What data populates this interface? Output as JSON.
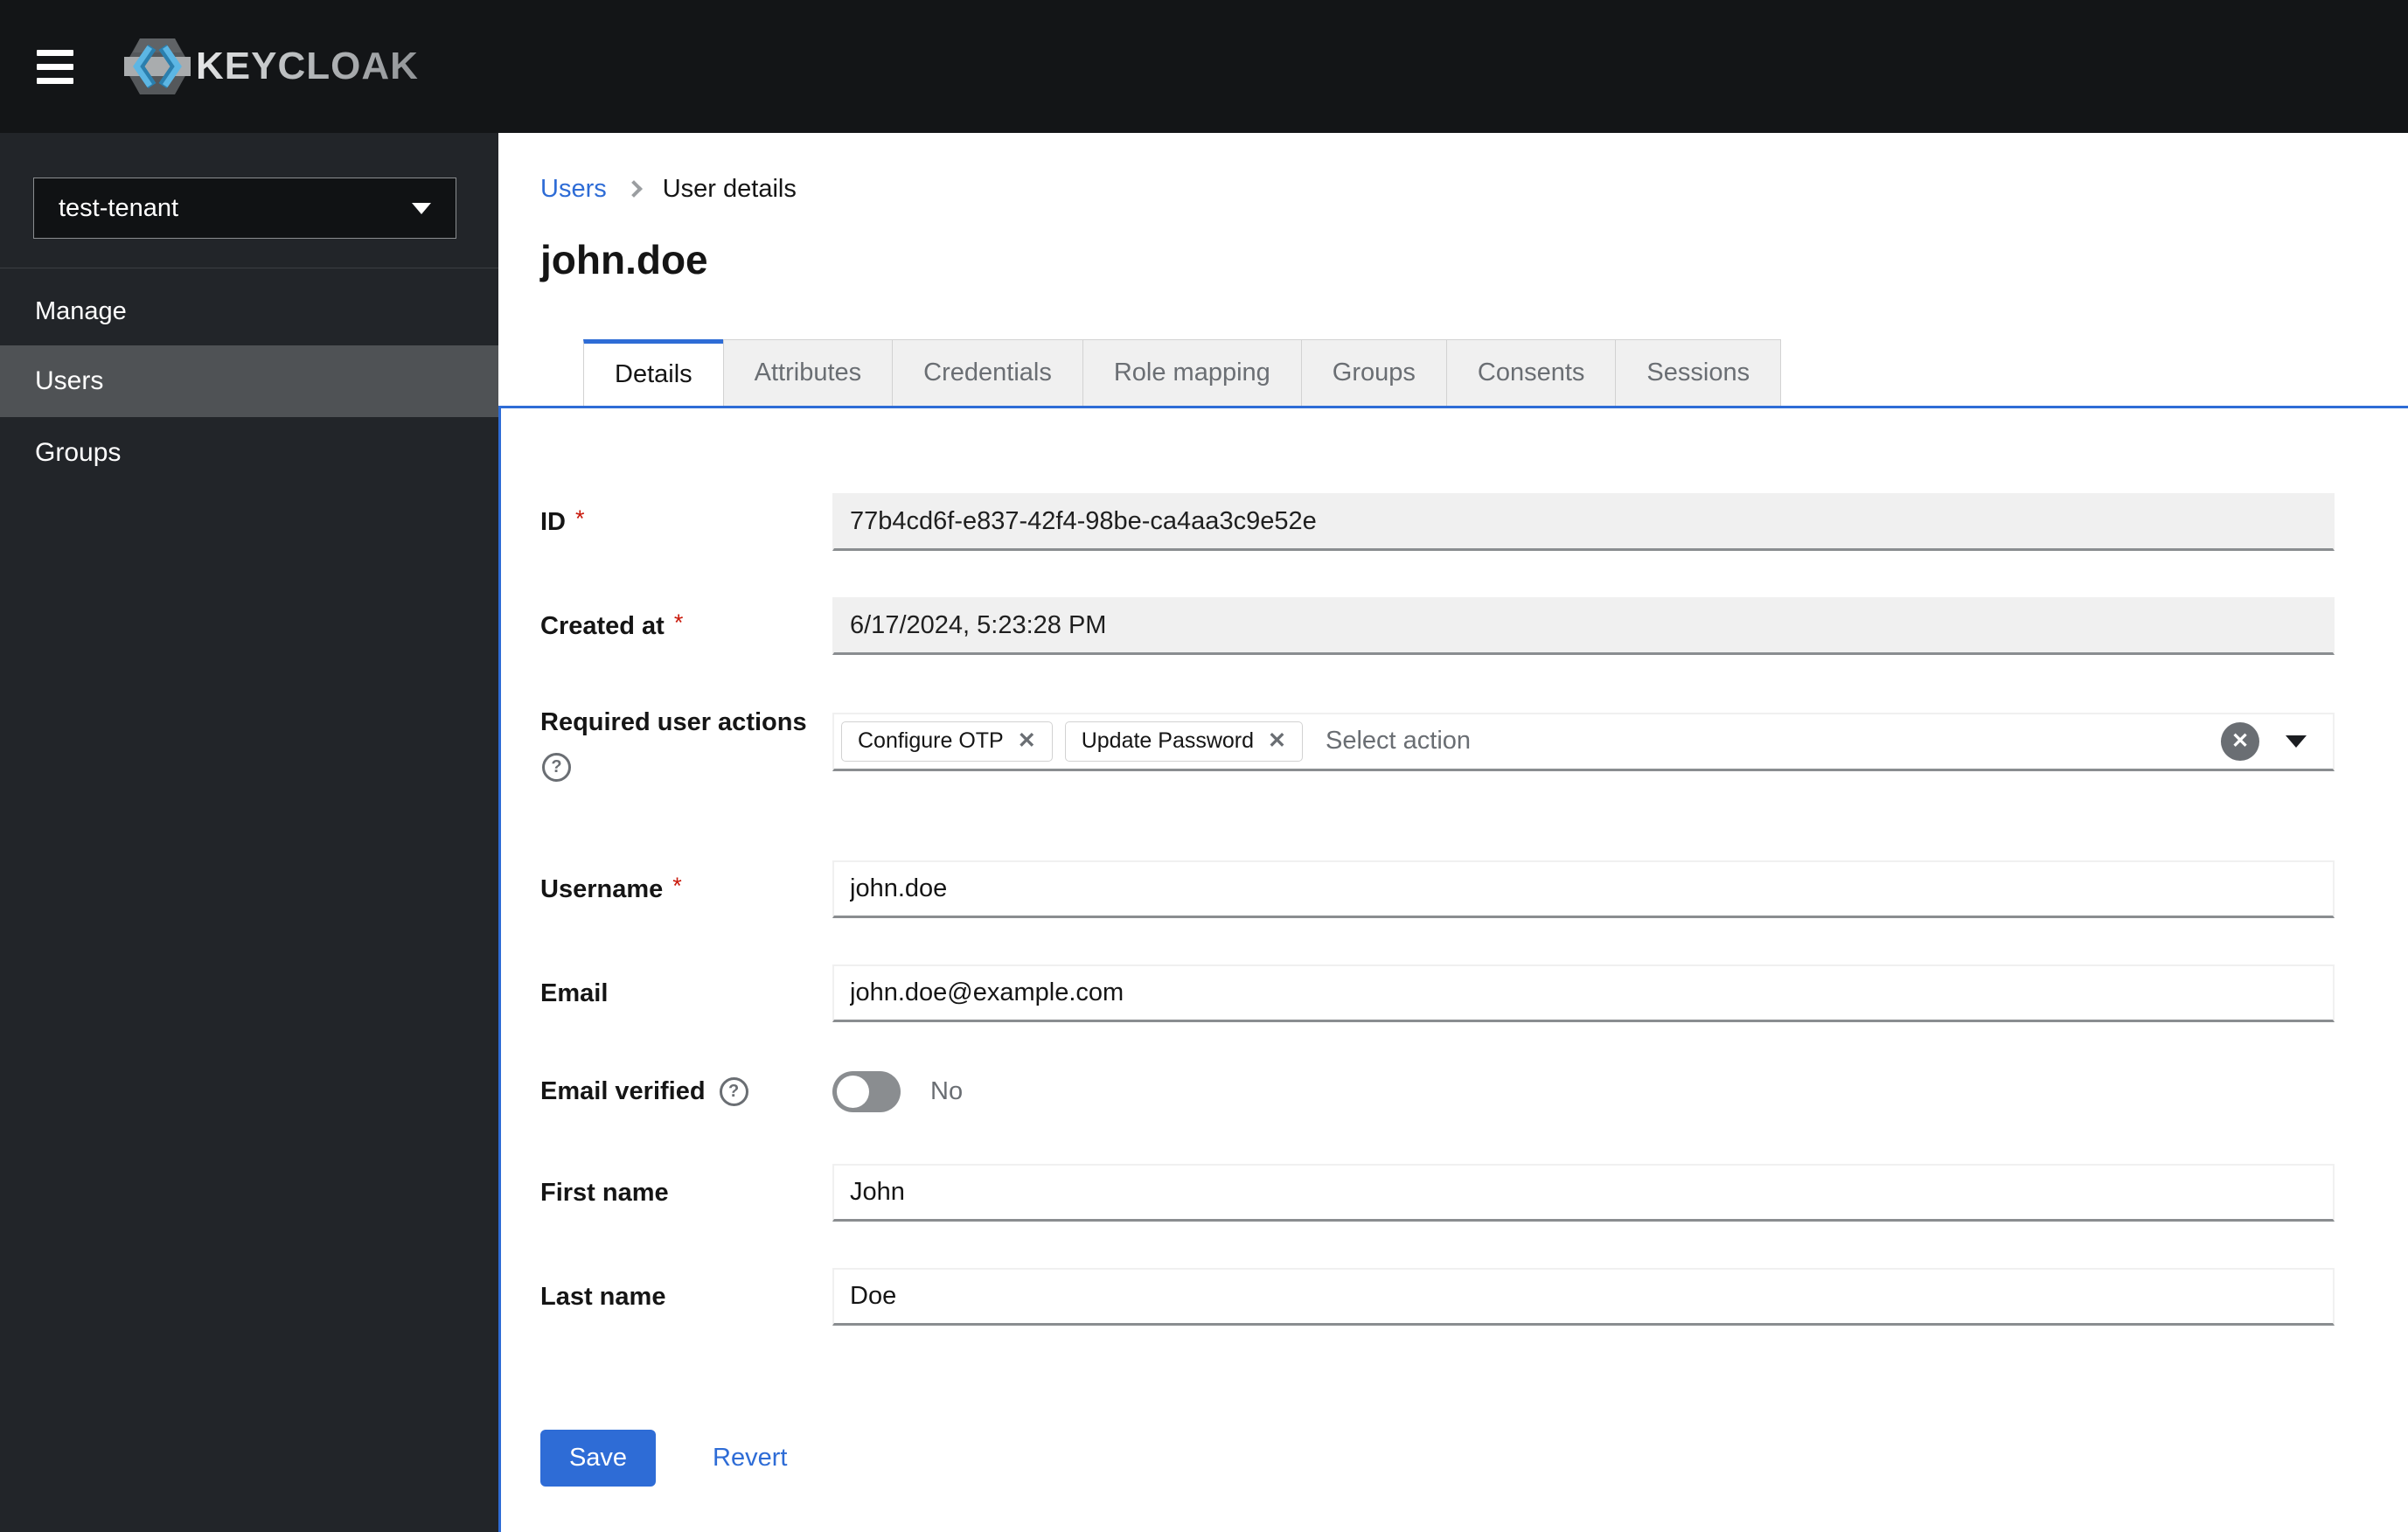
{
  "header": {
    "brand": "KEYCLOAK"
  },
  "sidebar": {
    "realm_selector": {
      "value": "test-tenant"
    },
    "section_label": "Manage",
    "items": [
      {
        "label": "Users",
        "active": true
      },
      {
        "label": "Groups",
        "active": false
      }
    ]
  },
  "breadcrumb": {
    "link": "Users",
    "current": "User details"
  },
  "page": {
    "title": "john.doe"
  },
  "tabs": [
    {
      "label": "Details",
      "active": true
    },
    {
      "label": "Attributes",
      "active": false
    },
    {
      "label": "Credentials",
      "active": false
    },
    {
      "label": "Role mapping",
      "active": false
    },
    {
      "label": "Groups",
      "active": false
    },
    {
      "label": "Consents",
      "active": false
    },
    {
      "label": "Sessions",
      "active": false
    }
  ],
  "form": {
    "required_indicator": "*",
    "fields": {
      "id": {
        "label": "ID",
        "required": true,
        "value": "77b4cd6f-e837-42f4-98be-ca4aa3c9e52e",
        "disabled": true
      },
      "created_at": {
        "label": "Created at",
        "required": true,
        "value": "6/17/2024, 5:23:28 PM",
        "disabled": true
      },
      "required_user_actions": {
        "label": "Required user actions",
        "chips": [
          "Configure OTP",
          "Update Password"
        ],
        "placeholder": "Select action"
      },
      "username": {
        "label": "Username",
        "required": true,
        "value": "john.doe"
      },
      "email": {
        "label": "Email",
        "value": "john.doe@example.com"
      },
      "email_verified": {
        "label": "Email verified",
        "state_label": "No",
        "on": false
      },
      "first_name": {
        "label": "First name",
        "value": "John"
      },
      "last_name": {
        "label": "Last name",
        "value": "Doe"
      }
    },
    "actions": {
      "save": "Save",
      "revert": "Revert"
    }
  },
  "icons": {
    "chip_remove": "✕",
    "clear_all": "✕",
    "help": "?"
  },
  "colors": {
    "accent": "#2e6cd6",
    "masthead": "#131517",
    "sidebar": "#222529",
    "sidebar_active_item": "#4f5255",
    "input_disabled_bg": "#f0f0f0",
    "input_bottom_border": "#8a8d90",
    "required_asterisk": "#c9190b",
    "muted_text": "#6a6e73"
  }
}
